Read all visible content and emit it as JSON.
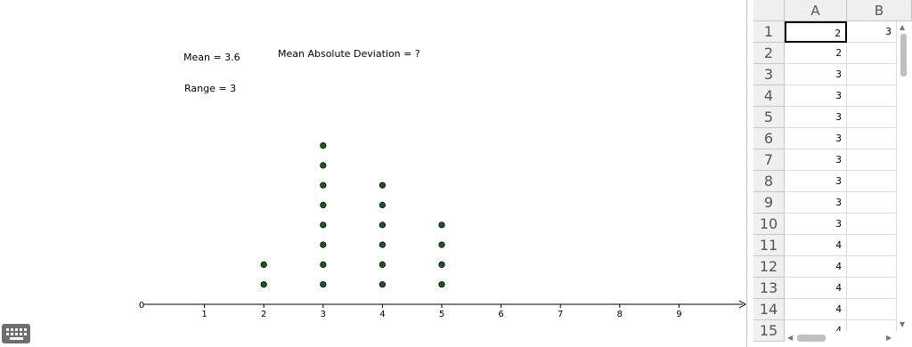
{
  "graphics": {
    "mean_text": "Mean = 3.6",
    "mad_text": "Mean Absolute Deviation = ?",
    "range_text": "Range = 3",
    "axis_origin_label": "0"
  },
  "chart_data": {
    "type": "scatter",
    "subtype": "dot-plot",
    "xlim": [
      0,
      10
    ],
    "x_ticks": [
      1,
      2,
      3,
      4,
      5,
      6,
      7,
      8,
      9
    ],
    "counts": [
      {
        "x": 2,
        "count": 2
      },
      {
        "x": 3,
        "count": 8
      },
      {
        "x": 4,
        "count": 6
      },
      {
        "x": 5,
        "count": 4
      }
    ],
    "dot_color": "#1e5a1e"
  },
  "spreadsheet": {
    "columns": [
      "A",
      "B"
    ],
    "selected_cell": "A1",
    "rows": [
      {
        "n": "1",
        "a": "2",
        "b": "3"
      },
      {
        "n": "2",
        "a": "2",
        "b": ""
      },
      {
        "n": "3",
        "a": "3",
        "b": ""
      },
      {
        "n": "4",
        "a": "3",
        "b": ""
      },
      {
        "n": "5",
        "a": "3",
        "b": ""
      },
      {
        "n": "6",
        "a": "3",
        "b": ""
      },
      {
        "n": "7",
        "a": "3",
        "b": ""
      },
      {
        "n": "8",
        "a": "3",
        "b": ""
      },
      {
        "n": "9",
        "a": "3",
        "b": ""
      },
      {
        "n": "10",
        "a": "3",
        "b": ""
      },
      {
        "n": "11",
        "a": "4",
        "b": ""
      },
      {
        "n": "12",
        "a": "4",
        "b": ""
      },
      {
        "n": "13",
        "a": "4",
        "b": ""
      },
      {
        "n": "14",
        "a": "4",
        "b": ""
      },
      {
        "n": "15",
        "a": "4",
        "b": ""
      }
    ]
  }
}
